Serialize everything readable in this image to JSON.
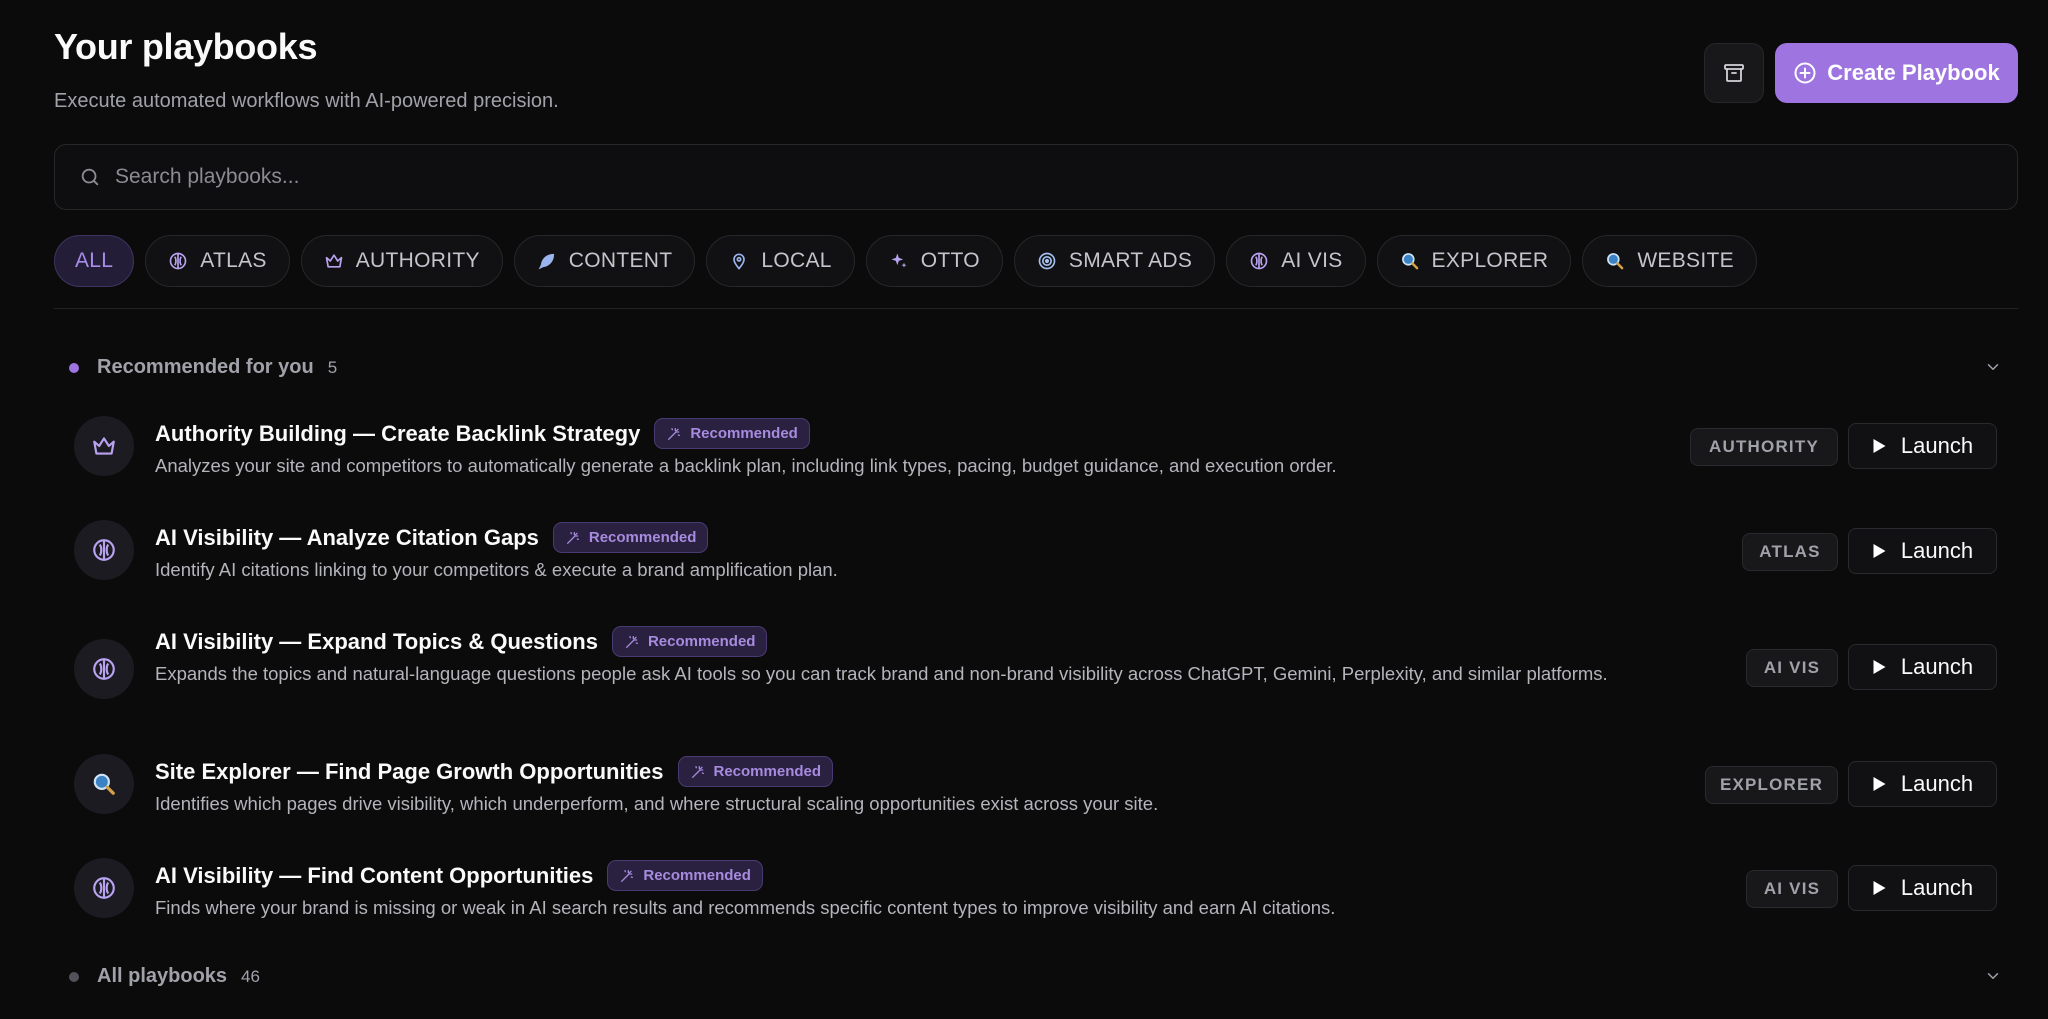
{
  "header": {
    "title": "Your playbooks",
    "subtitle": "Execute automated workflows with AI-powered precision.",
    "create_label": "Create Playbook"
  },
  "search": {
    "placeholder": "Search playbooks..."
  },
  "filters": [
    {
      "label": "ALL",
      "icon": "none",
      "active": true
    },
    {
      "label": "ATLAS",
      "icon": "brain-icon"
    },
    {
      "label": "AUTHORITY",
      "icon": "crown-icon"
    },
    {
      "label": "CONTENT",
      "icon": "feather-icon"
    },
    {
      "label": "LOCAL",
      "icon": "map-pin-icon"
    },
    {
      "label": "OTTO",
      "icon": "sparkles-icon"
    },
    {
      "label": "SMART ADS",
      "icon": "target-icon"
    },
    {
      "label": "AI VIS",
      "icon": "brain-icon"
    },
    {
      "label": "EXPLORER",
      "icon": "search-globe-icon"
    },
    {
      "label": "WEBSITE",
      "icon": "search-globe-icon"
    }
  ],
  "recommended": {
    "title": "Recommended for you",
    "count": "5",
    "badge_label": "Recommended",
    "launch_label": "Launch",
    "items": [
      {
        "title": "Authority Building — Create Backlink Strategy",
        "description": "Analyzes your site and competitors to automatically generate a backlink plan, including link types, pacing, budget guidance, and execution order.",
        "tag": "AUTHORITY",
        "icon": "crown-icon"
      },
      {
        "title": "AI Visibility — Analyze Citation Gaps",
        "description": "Identify AI citations linking to your competitors & execute a brand amplification plan.",
        "tag": "ATLAS",
        "icon": "brain-icon"
      },
      {
        "title": "AI Visibility — Expand Topics & Questions",
        "description": "Expands the topics and natural-language questions people ask AI tools so you can track brand and non-brand visibility across ChatGPT, Gemini, Perplexity, and similar platforms.",
        "tag": "AI VIS",
        "icon": "brain-icon"
      },
      {
        "title": "Site Explorer — Find Page Growth Opportunities",
        "description": "Identifies which pages drive visibility, which underperform, and where structural scaling opportunities exist across your site.",
        "tag": "EXPLORER",
        "icon": "search-globe-icon"
      },
      {
        "title": "AI Visibility — Find Content Opportunities",
        "description": "Finds where your brand is missing or weak in AI search results and recommends specific content types to improve visibility and earn AI citations.",
        "tag": "AI VIS",
        "icon": "brain-icon"
      }
    ]
  },
  "all_playbooks": {
    "title": "All playbooks",
    "count": "46"
  },
  "colors": {
    "accent": "#9d74e0",
    "background": "#0b0b0c",
    "badge_text": "#a78bdf"
  }
}
